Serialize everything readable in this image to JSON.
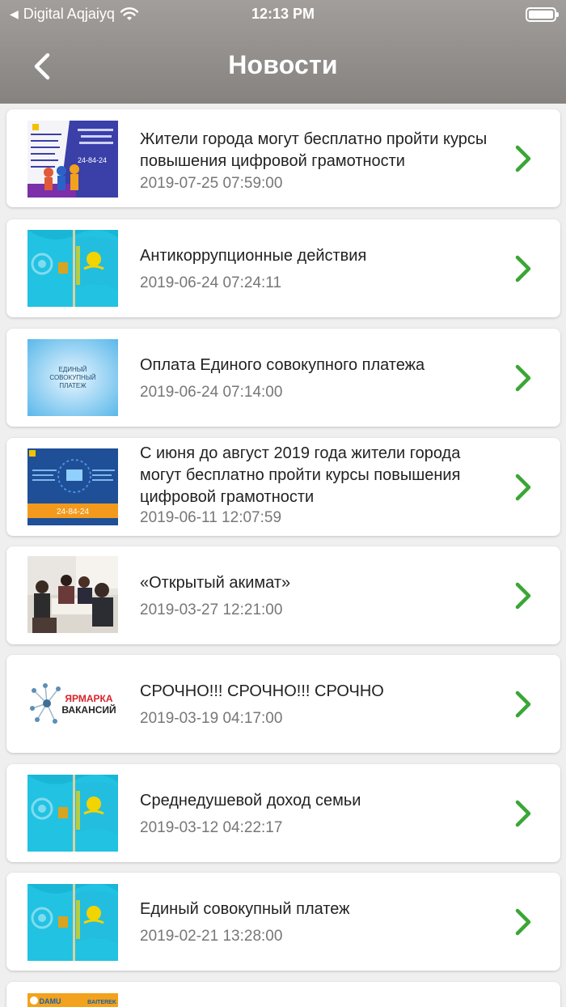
{
  "status": {
    "carrier": "Digital Aqjaiyq",
    "time": "12:13 PM"
  },
  "header": {
    "title": "Новости"
  },
  "colors": {
    "accent": "#3aa635",
    "header": "#95918e"
  },
  "news": [
    {
      "title": "Жители города могут бесплатно пройти курсы повышения цифровой грамотности",
      "date": "2019-07-25 07:59:00",
      "image": "digital-literacy-banner"
    },
    {
      "title": "Антикоррупционные действия",
      "date": "2019-06-24 07:24:11",
      "image": "kazakhstan-flag"
    },
    {
      "title": "Оплата Единого совокупного платежа",
      "date": "2019-06-24 07:14:00",
      "image": "single-payment-banner"
    },
    {
      "title": "С июня до август 2019 года жители города могут бесплатно пройти курсы повышения цифровой грамотности",
      "date": "2019-06-11 12:07:59",
      "image": "digital-courses-banner"
    },
    {
      "title": "«Открытый акимат»",
      "date": "2019-03-27 12:21:00",
      "image": "meeting-photo"
    },
    {
      "title": "СРОЧНО!!! СРОЧНО!!! СРОЧНО",
      "date": "2019-03-19 04:17:00",
      "image": "job-fair-banner"
    },
    {
      "title": "Среднедушевой доход семьи",
      "date": "2019-03-12 04:22:17",
      "image": "kazakhstan-flag"
    },
    {
      "title": "Единый совокупный платеж",
      "date": "2019-02-21 13:28:00",
      "image": "kazakhstan-flag"
    }
  ],
  "banners": {
    "single_payment": "ЕДИНЫЙ СОВОКУПНЫЙ ПЛАТЕЖ",
    "phone": "24-84-24",
    "job_fair": "ЯРМАРКА ВАКАНСИЙ",
    "damu": "DAMU",
    "baiterek": "BAITEREK"
  }
}
